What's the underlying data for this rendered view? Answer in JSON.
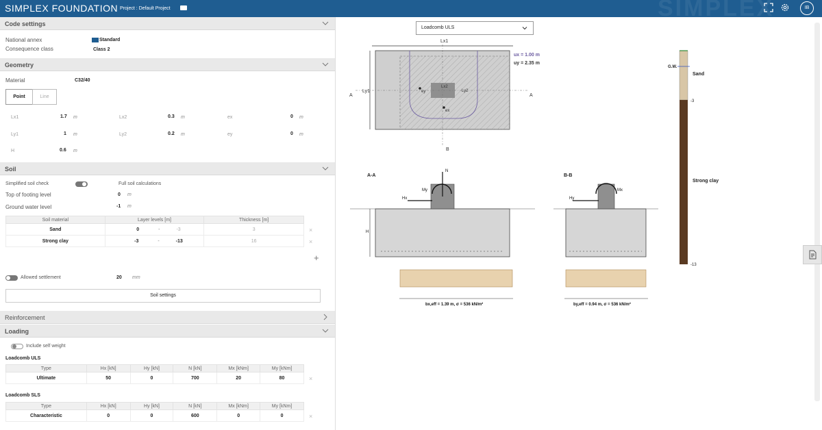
{
  "app": {
    "logo": "SIMPLEX FOUNDATION",
    "project_label": "Project : Default Project",
    "avatar": "IB",
    "watermark": "SIMPLEX"
  },
  "code_settings": {
    "title": "Code settings",
    "national_annex_label": "National annex",
    "national_annex_value": "Standard",
    "consequence_label": "Consequence class",
    "consequence_value": "Class 2"
  },
  "geometry": {
    "title": "Geometry",
    "material_label": "Material",
    "material_value": "C32/40",
    "tab_point": "Point",
    "tab_line": "Line",
    "lx1": {
      "sym": "Lx1",
      "val": "1.7",
      "unit": "m"
    },
    "ly1": {
      "sym": "Ly1",
      "val": "1",
      "unit": "m"
    },
    "h": {
      "sym": "H",
      "val": "0.6",
      "unit": "m"
    },
    "lx2": {
      "sym": "Lx2",
      "val": "0.3",
      "unit": "m"
    },
    "ly2": {
      "sym": "Ly2",
      "val": "0.2",
      "unit": "m"
    },
    "ex": {
      "sym": "ex",
      "val": "0",
      "unit": "m"
    },
    "ey": {
      "sym": "ey",
      "val": "0",
      "unit": "m"
    }
  },
  "soil": {
    "title": "Soil",
    "simplified_label": "Simplified soil check",
    "full_label": "Full soil calculations",
    "top_label": "Top of footing level",
    "top_val": "0",
    "top_unit": "m",
    "gw_label": "Ground water level",
    "gw_val": "-1",
    "gw_unit": "m",
    "headers": [
      "Soil material",
      "Layer levels [m]",
      "Thickness [m]"
    ],
    "rows": [
      {
        "material": "Sand",
        "top": "0",
        "dash": "-",
        "bottom": "-3",
        "thickness": "3"
      },
      {
        "material": "Strong clay",
        "top": "-3",
        "dash": "-",
        "bottom": "-13",
        "thickness": "16"
      }
    ],
    "add": "+",
    "remove": "×",
    "settlement_label": "Allowed settlement",
    "settlement_val": "20",
    "settlement_unit": "mm",
    "settings_button": "Soil settings"
  },
  "reinforcement": {
    "title": "Reinforcement"
  },
  "loading": {
    "title": "Loading",
    "self_weight_label": "Include self weight",
    "uls_title": "Loadcomb ULS",
    "sls_title": "Loadcomb SLS",
    "headers": [
      "Type",
      "Hx [kN]",
      "Hy [kN]",
      "N [kN]",
      "Mx [kNm]",
      "My [kNm]"
    ],
    "uls_row": [
      "Ultimate",
      "50",
      "0",
      "700",
      "20",
      "80"
    ],
    "sls_row": [
      "Characteristic",
      "0",
      "0",
      "600",
      "0",
      "0"
    ]
  },
  "drawing": {
    "loadcomb_select": "Loadcomb ULS",
    "ux_label": "ux = 1.00 m",
    "uy_label": "uy = 2.35 m",
    "lx1": "Lx1",
    "ly1": "Ly1",
    "lx2": "Lx2",
    "ly2": "Ly2",
    "ey": "ey",
    "ex": "ex",
    "sec_a": "A",
    "sec_b": "B",
    "aa_title": "A-A",
    "bb_title": "B-B",
    "n_label": "N",
    "my_label": "My",
    "mx_label": "Mx",
    "hx_label": "Hx",
    "hy_label": "Hy",
    "h_label": "H",
    "bx_label": "bx,eff = 1.39 m, σ = 536 kN/m²",
    "by_label": "by,eff = 0.94 m, σ = 536 kN/m²"
  },
  "profile": {
    "gw": "G.W.",
    "sand": "Sand",
    "clay": "Strong clay",
    "lvl_mid": "-3",
    "lvl_bottom": "-13"
  },
  "colors": {
    "header": "#1f5d91",
    "sand": "#d8c6a6",
    "clay": "#5a3a22",
    "concrete": "#d6d6d6"
  }
}
